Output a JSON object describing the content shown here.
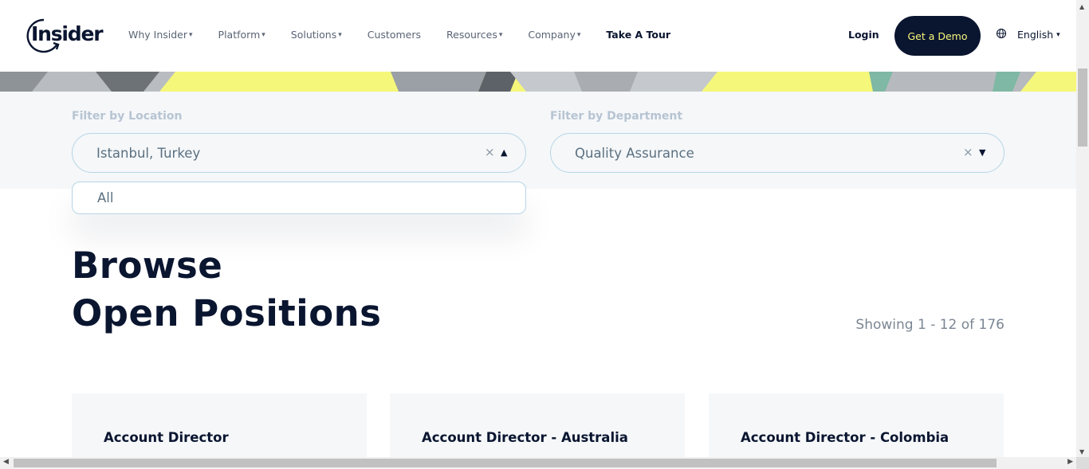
{
  "header": {
    "logo_text": "Insider",
    "nav": [
      {
        "label": "Why Insider",
        "has_caret": true
      },
      {
        "label": "Platform",
        "has_caret": true
      },
      {
        "label": "Solutions",
        "has_caret": true
      },
      {
        "label": "Customers",
        "has_caret": false
      },
      {
        "label": "Resources",
        "has_caret": true
      },
      {
        "label": "Company",
        "has_caret": true
      },
      {
        "label": "Take A Tour",
        "has_caret": false
      }
    ],
    "caret_glyph": "▾",
    "login_label": "Login",
    "demo_label": "Get a Demo",
    "language_label": "English",
    "language_caret": "▾",
    "globe_icon": "globe-icon"
  },
  "filters": {
    "location": {
      "label": "Filter by Location",
      "value": "Istanbul, Turkey",
      "clear_glyph": "×",
      "arrow_glyph": "▲",
      "open": true,
      "options": [
        "All"
      ]
    },
    "department": {
      "label": "Filter by Department",
      "value": "Quality Assurance",
      "clear_glyph": "×",
      "arrow_glyph": "▼"
    }
  },
  "listing": {
    "title_line1": "Browse",
    "title_line2": "Open Positions",
    "showing": "Showing 1 - 12 of 176",
    "cards": [
      {
        "title": "Account Director"
      },
      {
        "title": "Account Director - Australia"
      },
      {
        "title": "Account Director - Colombia"
      }
    ]
  },
  "colors": {
    "brand_navy": "#0a1530",
    "accent_yellow": "#f5f77a",
    "filter_bg": "#f5f7f9",
    "border_blue": "#b6d6e6"
  }
}
